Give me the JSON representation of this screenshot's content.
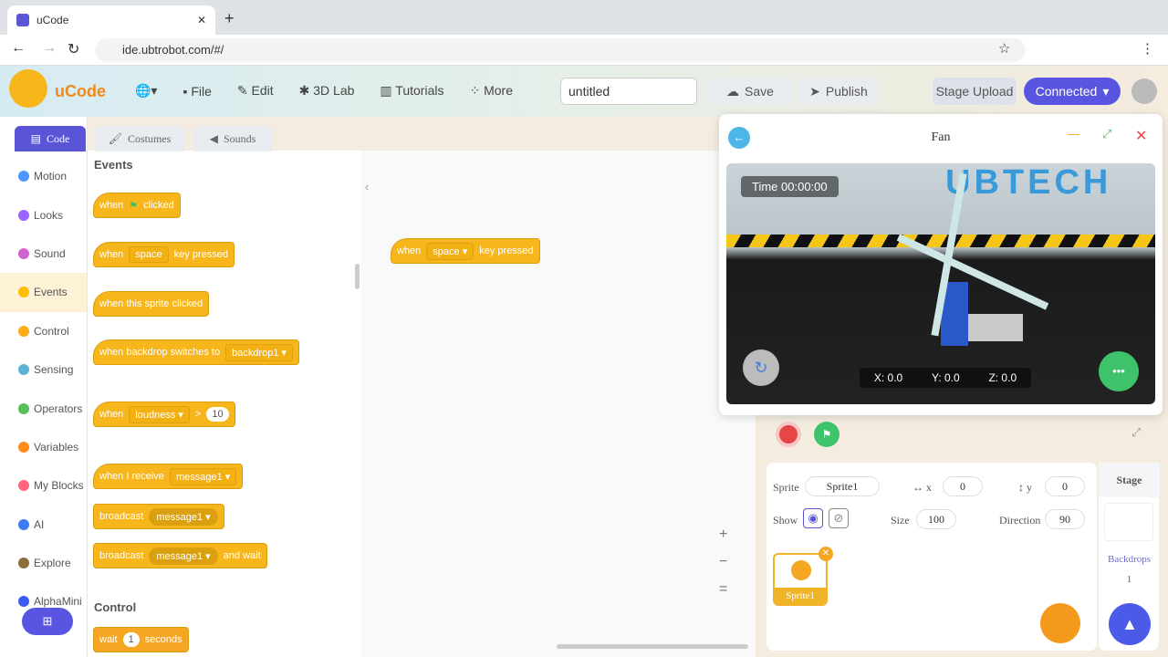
{
  "browser": {
    "tab_title": "uCode",
    "url": "ide.ubtrobot.com/#/"
  },
  "header": {
    "logo": "uCode",
    "menu": [
      "File",
      "Edit",
      "3D Lab",
      "Tutorials",
      "More"
    ],
    "project_name": "untitled",
    "save": "Save",
    "publish": "Publish",
    "stage_upload": "Stage Upload",
    "connected": "Connected"
  },
  "tabs": [
    "Code",
    "Costumes",
    "Sounds"
  ],
  "categories": [
    {
      "label": "Motion",
      "color": "#4c97ff"
    },
    {
      "label": "Looks",
      "color": "#9966ff"
    },
    {
      "label": "Sound",
      "color": "#cf63cf"
    },
    {
      "label": "Events",
      "color": "#ffbf00"
    },
    {
      "label": "Control",
      "color": "#ffab19"
    },
    {
      "label": "Sensing",
      "color": "#5cb1d6"
    },
    {
      "label": "Operators",
      "color": "#59c059"
    },
    {
      "label": "Variables",
      "color": "#ff8c1a"
    },
    {
      "label": "My Blocks",
      "color": "#ff6680"
    },
    {
      "label": "AI",
      "color": "#3d7cf0"
    },
    {
      "label": "Explore",
      "color": "#8a6d3b"
    },
    {
      "label": "AlphaMini",
      "color": "#3d5af0"
    }
  ],
  "palette": {
    "events_heading": "Events",
    "control_heading": "Control",
    "b1": {
      "when": "when",
      "clicked": "clicked"
    },
    "b2": {
      "when": "when",
      "key": "space",
      "pressed": "key pressed"
    },
    "b3": "when this sprite clicked",
    "b4": {
      "text": "when backdrop switches to",
      "value": "backdrop1"
    },
    "b5": {
      "when": "when",
      "value": "loudness",
      "op": ">",
      "num": "10"
    },
    "b6": {
      "text": "when I receive",
      "value": "message1"
    },
    "b7": {
      "text": "broadcast",
      "value": "message1"
    },
    "b8": {
      "text": "broadcast",
      "value": "message1",
      "suffix": "and wait"
    },
    "b9": {
      "text": "wait",
      "num": "1",
      "suffix": "seconds"
    }
  },
  "script": {
    "when": "when",
    "key": "space",
    "pressed": "key pressed"
  },
  "stage_window": {
    "title": "Fan",
    "time": "Time 00:00:00",
    "x": "X: 0.0",
    "y": "Y: 0.0",
    "z": "Z: 0.0",
    "banner": "UBTECH"
  },
  "sprite": {
    "sprite_label": "Sprite",
    "name": "Sprite1",
    "x_label": "x",
    "x": "0",
    "y_label": "y",
    "y": "0",
    "show_label": "Show",
    "size_label": "Size",
    "size": "100",
    "direction_label": "Direction",
    "direction": "90",
    "thumb": "Sprite1"
  },
  "stage_panel": {
    "title": "Stage",
    "backdrops_label": "Backdrops",
    "backdrops": "1"
  }
}
